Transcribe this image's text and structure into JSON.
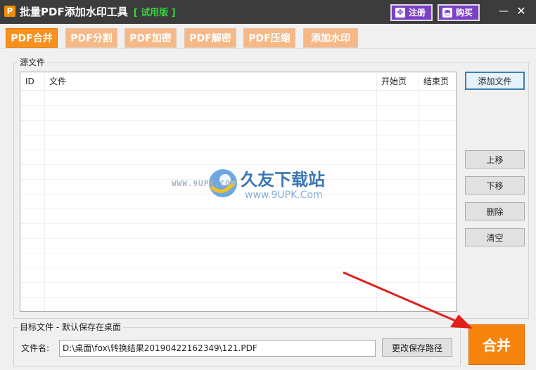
{
  "window": {
    "icon_letter": "P",
    "title": "批量PDF添加水印工具",
    "trial_badge": "[ 试用版 ]",
    "register_label": "注册",
    "buy_label": "购买",
    "minimize_glyph": "—",
    "close_glyph": "✕"
  },
  "tabs": [
    {
      "label": "PDF合并",
      "active": true
    },
    {
      "label": "PDF分割",
      "active": false
    },
    {
      "label": "PDF加密",
      "active": false
    },
    {
      "label": "PDF解密",
      "active": false
    },
    {
      "label": "PDF压缩",
      "active": false
    },
    {
      "label": "添加水印",
      "active": false
    }
  ],
  "source": {
    "group_title": "源文件",
    "columns": [
      "ID",
      "文件",
      "开始页",
      "结束页"
    ],
    "rows": []
  },
  "side_buttons": {
    "add_file": "添加文件",
    "move_up": "上移",
    "move_down": "下移",
    "delete": "删除",
    "clear": "清空"
  },
  "target": {
    "group_title": "目标文件 - 默认保存在桌面",
    "filename_label": "文件名:",
    "filename_value": "D:\\桌面\\fox\\转换结果20190422162349\\121.PDF",
    "change_path_label": "更改保存路径"
  },
  "merge_button": "合并",
  "watermark": {
    "url": "WWW.9UPK.COM",
    "name": "久友下载站",
    "sub": "www.9UPK.Com"
  },
  "colors": {
    "titlebar": "#3c3c3c",
    "tab_active": "#f7901e",
    "tab_inactive": "#f5b886",
    "accent_purple": "#7c3fc8",
    "merge_orange": "#f7840d",
    "arrow_red": "#e0201c"
  }
}
